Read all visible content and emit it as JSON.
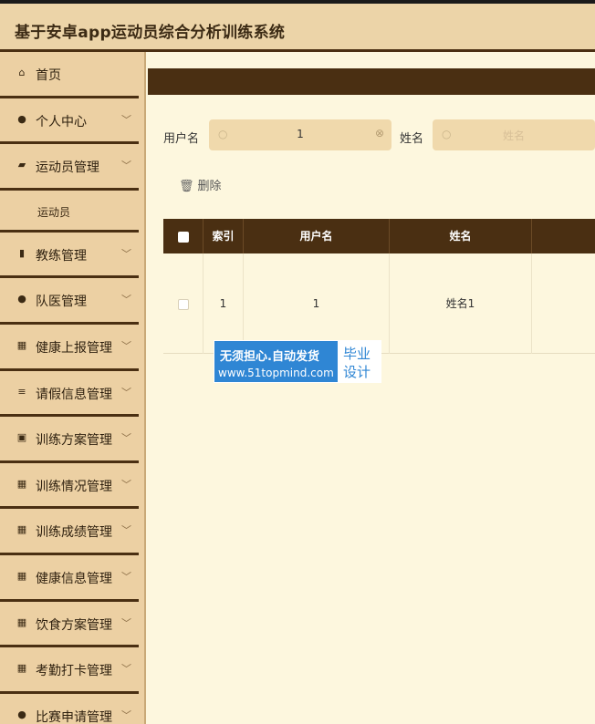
{
  "app": {
    "title": "基于安卓app运动员综合分析训练系统"
  },
  "sidebar": {
    "items": [
      {
        "label": "首页",
        "icon": "home-icon",
        "glyph": "⌂",
        "has_chevron": false
      },
      {
        "label": "个人中心",
        "icon": "user-icon",
        "glyph": "●",
        "has_chevron": true
      },
      {
        "label": "运动员管理",
        "icon": "wallet-icon",
        "glyph": "▰",
        "has_chevron": true
      },
      {
        "label": "运动员",
        "submenu": true
      },
      {
        "label": "教练管理",
        "icon": "book-icon",
        "glyph": "▮",
        "has_chevron": true
      },
      {
        "label": "队医管理",
        "icon": "user-icon",
        "glyph": "●",
        "has_chevron": true
      },
      {
        "label": "健康上报管理",
        "icon": "grid-icon",
        "glyph": "▦",
        "has_chevron": true
      },
      {
        "label": "请假信息管理",
        "icon": "list-icon",
        "glyph": "≡",
        "has_chevron": true
      },
      {
        "label": "训练方案管理",
        "icon": "calendar-x-icon",
        "glyph": "▣",
        "has_chevron": true
      },
      {
        "label": "训练情况管理",
        "icon": "grid-icon",
        "glyph": "▦",
        "has_chevron": true
      },
      {
        "label": "训练成绩管理",
        "icon": "grid-icon",
        "glyph": "▦",
        "has_chevron": true
      },
      {
        "label": "健康信息管理",
        "icon": "grid-icon",
        "glyph": "▦",
        "has_chevron": true
      },
      {
        "label": "饮食方案管理",
        "icon": "apps-icon",
        "glyph": "▦",
        "has_chevron": true
      },
      {
        "label": "考勤打卡管理",
        "icon": "grid-icon",
        "glyph": "▦",
        "has_chevron": true
      },
      {
        "label": "比赛申请管理",
        "icon": "user-icon",
        "glyph": "●",
        "has_chevron": true
      }
    ]
  },
  "search": {
    "username_label": "用户名",
    "username_value": "1",
    "name_label": "姓名",
    "name_placeholder": "姓名"
  },
  "toolbar": {
    "delete_label": "删除"
  },
  "table": {
    "headers": [
      "索引",
      "用户名",
      "姓名"
    ],
    "rows": [
      {
        "index": "1",
        "username": "1",
        "name": "姓名1"
      }
    ]
  },
  "watermark": {
    "line1": "无须担心.自动发货",
    "line2": "www.51topmind.com",
    "right1": "毕业",
    "right2": "设计"
  },
  "colors": {
    "accent_dark": "#4a2f12",
    "sidebar_bg": "#ecd0a3",
    "main_bg": "#fdf7de"
  }
}
